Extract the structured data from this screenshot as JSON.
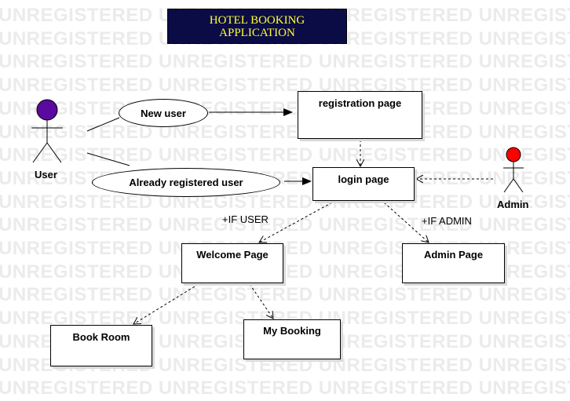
{
  "title": "HOTEL BOOKING\nAPPLICATION",
  "watermark": "UNREGISTERED",
  "colors": {
    "title_bg": "#0b0b45",
    "title_text": "#ffff33",
    "user_head": "#5a0a9e",
    "admin_head": "#ff0000"
  },
  "actors": {
    "user": "User",
    "admin": "Admin"
  },
  "use_cases": {
    "new_user": "New user",
    "already_registered": "Already registered user"
  },
  "pages": {
    "registration": "registration page",
    "login": "login page",
    "welcome": "Welcome Page",
    "admin": "Admin Page",
    "book_room": "Book Room",
    "my_booking": "My Booking"
  },
  "labels": {
    "if_user": "+IF USER",
    "if_admin": "+IF ADMIN"
  }
}
